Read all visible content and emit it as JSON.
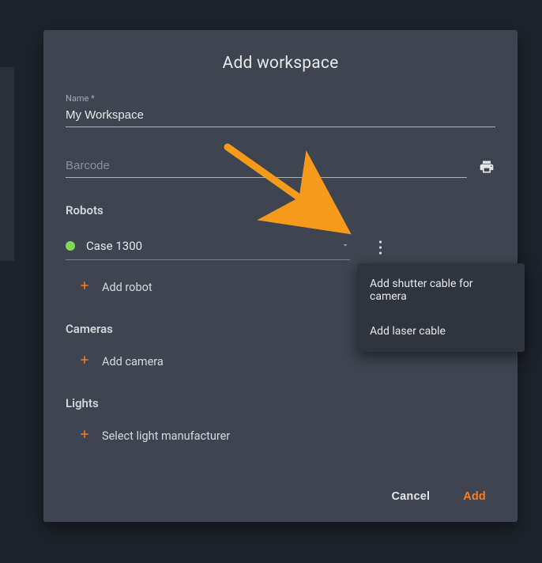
{
  "dialog": {
    "title": "Add workspace",
    "name_field": {
      "label": "Name *",
      "value": "My Workspace"
    },
    "barcode_field": {
      "placeholder": "Barcode"
    },
    "robots_section": {
      "title": "Robots",
      "selected_robot": "Case 1300",
      "add_button_label": "Add robot"
    },
    "cameras_section": {
      "title": "Cameras",
      "add_button_label": "Add camera"
    },
    "lights_section": {
      "title": "Lights",
      "add_button_label": "Select light manufacturer"
    },
    "footer": {
      "cancel_label": "Cancel",
      "add_label": "Add"
    }
  },
  "context_menu": {
    "items": [
      "Add shutter cable for camera",
      "Add laser cable"
    ]
  },
  "colors": {
    "accent": "#ff7a1a",
    "status_ok": "#7ed957",
    "dialog_bg": "#3e4550",
    "page_bg": "#1e232b",
    "menu_bg": "#2f343d"
  }
}
